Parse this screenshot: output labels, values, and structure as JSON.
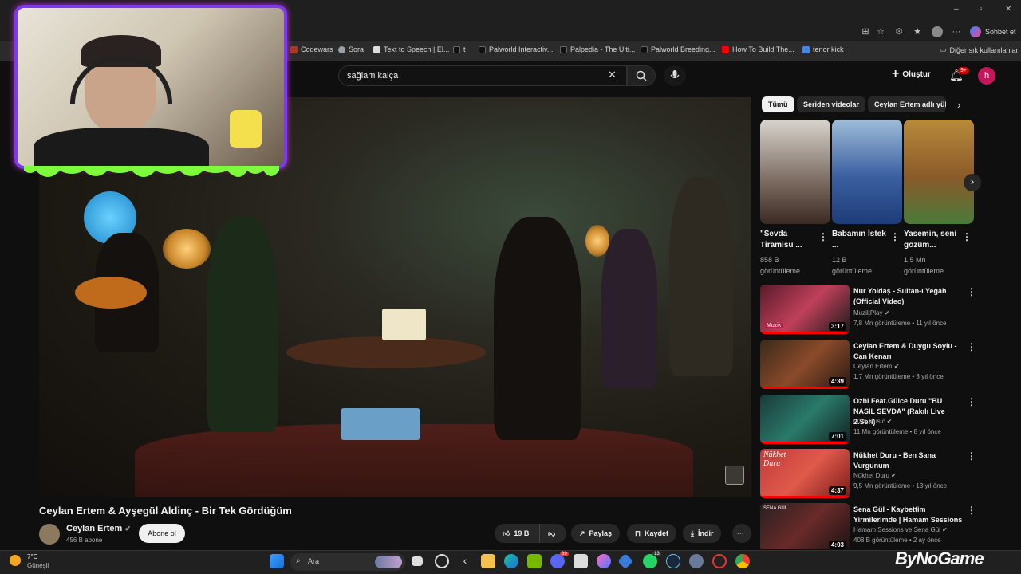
{
  "browser": {
    "bookmarks": [
      {
        "label": "Codewars"
      },
      {
        "label": "Sora"
      },
      {
        "label": "Text to Speech | El..."
      },
      {
        "label": "t"
      },
      {
        "label": "Palworld Interactiv..."
      },
      {
        "label": "Palpedia - The Ulti..."
      },
      {
        "label": "Palworld Breeding..."
      },
      {
        "label": "How To Build The..."
      },
      {
        "label": "tenor kick"
      }
    ],
    "other_bookmarks": "Diğer sık kullanılanlar",
    "chat_label": "Sohbet et"
  },
  "youtube": {
    "search_value": "sağlam kalça",
    "create_label": "Oluştur",
    "notif_count": "9+",
    "profile_letter": "h"
  },
  "video": {
    "title": "Ceylan Ertem & Ayşegül Aldinç - Bir Tek Gördüğüm",
    "channel": "Ceylan Ertem",
    "subscribers": "456 B abone",
    "subscribe_label": "Abone ol",
    "likes": "19 B",
    "share_label": "Paylaş",
    "save_label": "Kaydet",
    "download_label": "İndir"
  },
  "sidebar": {
    "chips": [
      "Tümü",
      "Seriden videolar",
      "Ceylan Ertem adlı yük"
    ],
    "shorts": [
      {
        "title": "\"Sevda Tiramisu ...",
        "views": "858 B görüntüleme"
      },
      {
        "title": "Babamın İstek ...",
        "views": "12 B görüntüleme"
      },
      {
        "title": "Yasemin, seni gözüm...",
        "views": "1,5 Mn görüntüleme"
      }
    ],
    "recs": [
      {
        "title": "Nur Yoldaş - Sultan-ı Yegâh (Official Video)",
        "channel": "MuzikPlay",
        "meta": "7,8 Mn görüntüleme • 11 yıl önce",
        "duration": "3:17",
        "thumb_text": "Muzik"
      },
      {
        "title": "Ceylan Ertem & Duygu Soylu - Can Kenarı",
        "channel": "Ceylan Ertem",
        "meta": "1,7 Mn görüntüleme • 3 yıl önce",
        "duration": "4:39",
        "thumb_text": ""
      },
      {
        "title": "Ozbi Feat.Gülce Duru \"BU NASIL SEVDA\" (Rakılı Live 2.Seri)",
        "channel": "Ozbi Music",
        "meta": "11 Mn görüntüleme • 8 yıl önce",
        "duration": "7:01",
        "thumb_text": ""
      },
      {
        "title": "Nükhet Duru - Ben Sana Vurgunum",
        "channel": "Nükhet Duru",
        "meta": "9,5 Mn görüntüleme • 13 yıl önce",
        "duration": "4:37",
        "thumb_text": "Nükhet Duru"
      },
      {
        "title": "Sena Gül - Kaybettim Yirmilerimde | Hamam Sessions",
        "channel": "Hamam Sessions ve Sena Gül",
        "meta": "408 B görüntüleme • 2 ay önce",
        "duration": "4:03",
        "thumb_text": "SENA GÜL"
      }
    ]
  },
  "taskbar": {
    "weather_temp": "7°C",
    "weather_desc": "Güneşli",
    "search_placeholder": "Ara",
    "badge_1": "39",
    "badge_2": "13"
  },
  "watermark": "ByNoGame"
}
